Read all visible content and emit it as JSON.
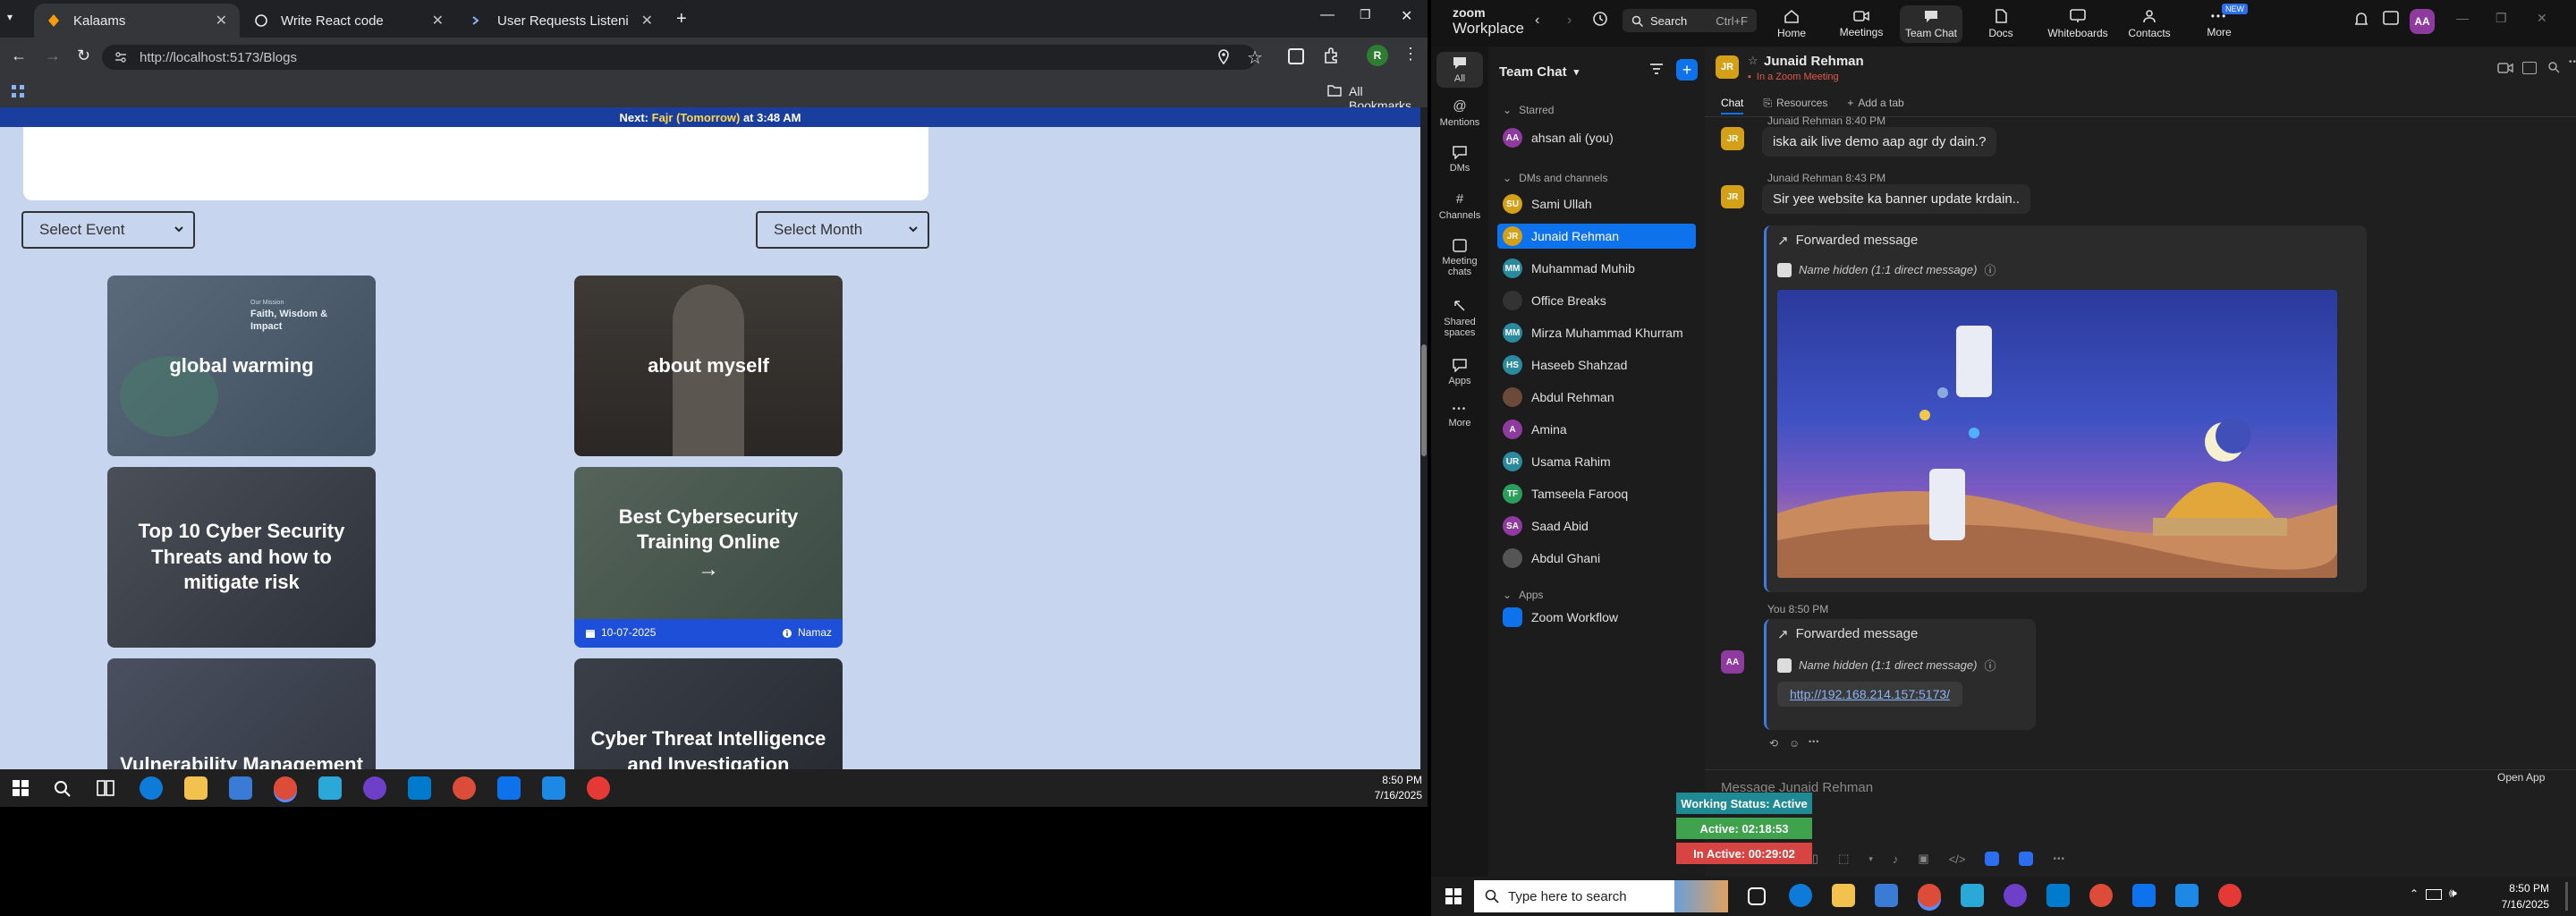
{
  "browser": {
    "tabs": [
      {
        "label": "Kalaams",
        "active": true
      },
      {
        "label": "Write React code",
        "active": false
      },
      {
        "label": "User Requests Listening Assista",
        "active": false
      }
    ],
    "url": "http://localhost:5173/Blogs",
    "all_bookmarks": "All Bookmarks",
    "profile_initial": "R"
  },
  "page": {
    "notice_next": "Next: ",
    "notice_prayer": "Fajr (Tomorrow)",
    "notice_time": " at 3:48 AM",
    "select_event": "Select Event",
    "select_month": "Select Month",
    "cards": [
      {
        "title": "global warming",
        "thumb_small": "Our Mission",
        "thumb_heading": "Faith, Wisdom & Impact"
      },
      {
        "title": "about myself"
      },
      {
        "title": "Top 10 Cyber Security Threats and how to mitigate risk"
      },
      {
        "title": "Best Cybersecurity Training Online",
        "arrow": "→",
        "date": "10-07-2025",
        "category": "Namaz"
      },
      {
        "title": "Vulnerability Management Program"
      },
      {
        "title": "Cyber Threat Intelligence and Investigation Platform"
      }
    ]
  },
  "left_taskbar": {
    "time": "8:50 PM",
    "date": "7/16/2025"
  },
  "zoom": {
    "brand_top": "zoom",
    "brand_bottom": "Workplace",
    "search_label": "Search",
    "search_shortcut": "Ctrl+F",
    "nav": [
      {
        "label": "Home"
      },
      {
        "label": "Meetings"
      },
      {
        "label": "Team Chat",
        "active": true
      },
      {
        "label": "Docs"
      },
      {
        "label": "Whiteboards"
      },
      {
        "label": "Contacts"
      },
      {
        "label": "More",
        "badge": "NEW"
      }
    ],
    "user_initials": "AA",
    "rail": [
      {
        "label": "All"
      },
      {
        "label": "Mentions"
      },
      {
        "label": "DMs"
      },
      {
        "label": "Channels"
      },
      {
        "label": "Meeting chats"
      },
      {
        "label": "Shared spaces"
      },
      {
        "label": "Apps"
      },
      {
        "label": "More"
      }
    ],
    "list_title": "Team Chat",
    "sections": {
      "starred": "Starred",
      "dms": "DMs and channels",
      "apps": "Apps"
    },
    "starred_contact": {
      "name": "ahsan ali (you)",
      "initials": "AA",
      "color": "#8e3a9e"
    },
    "contacts": [
      {
        "name": "Sami Ullah",
        "initials": "SU",
        "color": "#d4a017"
      },
      {
        "name": "Junaid Rehman",
        "initials": "JR",
        "color": "#d4a017",
        "selected": true
      },
      {
        "name": "Muhammad Muhib",
        "initials": "MM",
        "color": "#2a8a9e"
      },
      {
        "name": "Office Breaks",
        "initials": "",
        "color": "#333333"
      },
      {
        "name": "Mirza Muhammad Khurram",
        "initials": "MM",
        "color": "#2a8a9e"
      },
      {
        "name": "Haseeb Shahzad",
        "initials": "HS",
        "color": "#2a8a9e"
      },
      {
        "name": "Abdul Rehman",
        "initials": "",
        "color": "#6b4a3a"
      },
      {
        "name": "Amina",
        "initials": "A",
        "color": "#8e3a9e"
      },
      {
        "name": "Usama Rahim",
        "initials": "UR",
        "color": "#2a8a9e"
      },
      {
        "name": "Tamseela Farooq",
        "initials": "TF",
        "color": "#2a9e5a"
      },
      {
        "name": "Saad Abid",
        "initials": "SA",
        "color": "#8e3a9e"
      },
      {
        "name": "Abdul Ghani",
        "initials": "",
        "color": "#555555"
      }
    ],
    "app_entry": {
      "name": "Zoom Workflow"
    },
    "chat": {
      "contact_name": "Junaid Rehman",
      "contact_initials": "JR",
      "contact_status": "In a Zoom Meeting",
      "tabs": [
        "Chat",
        "Resources",
        "Add a tab"
      ],
      "messages": [
        {
          "sender": "Junaid Rehman 8:40 PM",
          "text": "iska aik live demo aap agr dy dain.?"
        },
        {
          "sender": "Junaid Rehman 8:43 PM",
          "text": "Sir yee website ka banner update krdain.."
        }
      ],
      "forwarded_label": "Forwarded message",
      "name_hidden": "Name hidden (1:1 direct message)",
      "my_sender": "You 8:50 PM",
      "my_initials": "AA",
      "my_link": "http://192.168.214.157:5173/",
      "input_placeholder": "Message Junaid Rehman"
    },
    "open_app": "Open App",
    "status_working": "Working Status: Active",
    "status_active": "Active: 02:18:53",
    "status_inactive": "In Active: 00:29:02",
    "status_colors": {
      "working": "#1f8a94",
      "active": "#3fa34d",
      "inactive": "#d64541"
    }
  },
  "win_taskbar": {
    "search_placeholder": "Type here to search",
    "time": "8:50 PM",
    "date": "7/16/2025"
  }
}
